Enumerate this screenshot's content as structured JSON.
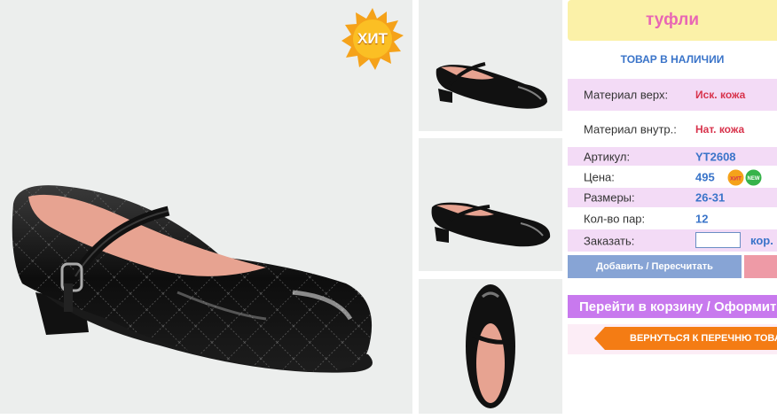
{
  "main_image": {
    "badge": "ХИТ",
    "icon": "shoe-photo"
  },
  "thumbnails": [
    {
      "icon": "shoe-side-photo"
    },
    {
      "icon": "shoe-side-photo"
    },
    {
      "icon": "shoe-top-photo"
    }
  ],
  "product": {
    "title": "туфли",
    "stock_status": "ТОВАР В НАЛИЧИИ",
    "specs": [
      {
        "label": "Материал верх:",
        "value": "Иск. кожа"
      },
      {
        "label": "Материал внутр.:",
        "value": "Нат. кожа"
      },
      {
        "label": "Артикул:",
        "value": "YT2608"
      },
      {
        "label": "Цена:",
        "value": "495"
      },
      {
        "label": "Размеры:",
        "value": "26-31"
      },
      {
        "label": "Кол-во пар:",
        "value": "12"
      },
      {
        "label": "Заказать:",
        "value": ""
      }
    ],
    "price_badges": {
      "hit": "ХИТ",
      "new": "NEW"
    },
    "order_unit": "кор."
  },
  "buttons": {
    "add": "Добавить / Пересчитать",
    "cart": "Перейти в корзину / Оформить",
    "back": "ВЕРНУТЬСЯ К ПЕРЕЧНЮ ТОВАРОВ"
  },
  "colors": {
    "title_bg": "#fbf1a8",
    "title_text": "#e867b4",
    "row_pink": "#f3dbf6",
    "accent_blue": "#3a74c9",
    "accent_red": "#d8334c",
    "cart_purple": "#c879ee",
    "back_orange": "#f47c14"
  }
}
